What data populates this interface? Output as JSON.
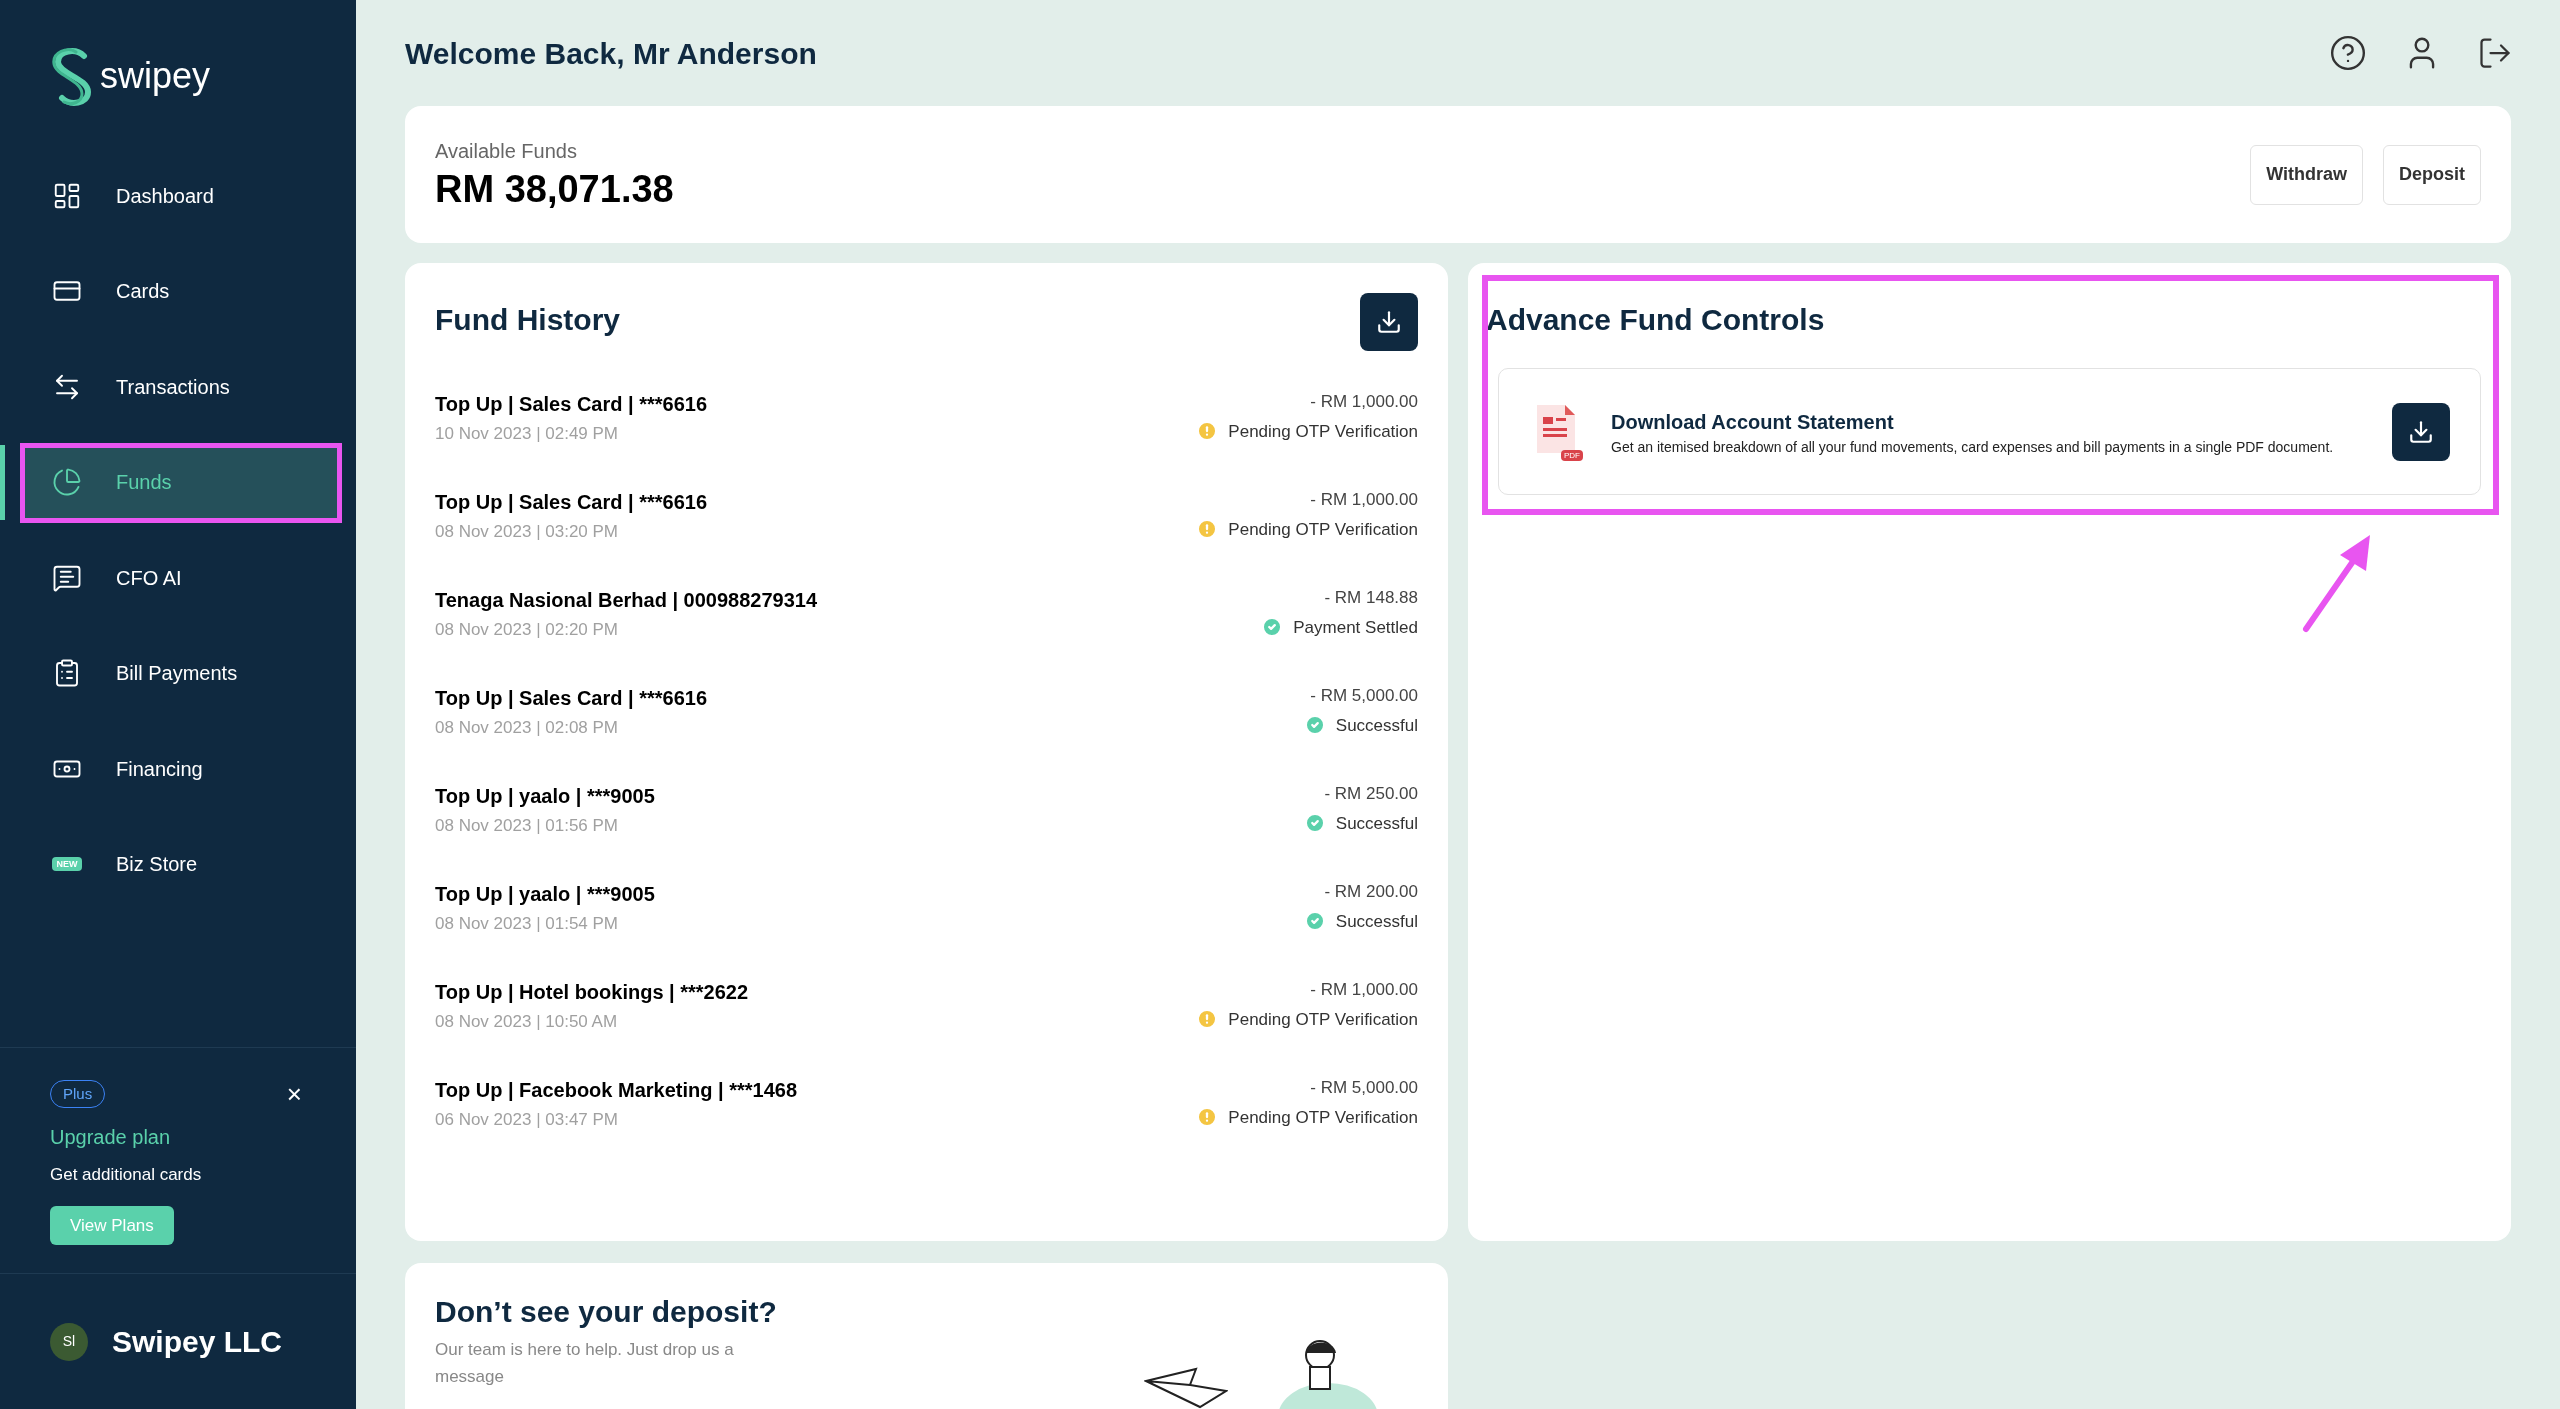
{
  "sidebar": {
    "logo": "swipey",
    "items": [
      {
        "label": "Dashboard",
        "selected": false,
        "annotated": false
      },
      {
        "label": "Cards",
        "selected": false,
        "annotated": false
      },
      {
        "label": "Transactions",
        "selected": false,
        "annotated": false
      },
      {
        "label": "Funds",
        "selected": true,
        "annotated": true
      },
      {
        "label": "CFO AI",
        "selected": false,
        "annotated": false
      },
      {
        "label": "Bill Payments",
        "selected": false,
        "annotated": false
      },
      {
        "label": "Financing",
        "selected": false,
        "annotated": false
      },
      {
        "label": "Biz Store",
        "selected": false,
        "annotated": false,
        "badge": "NEW"
      }
    ],
    "upgrade": {
      "badge": "Plus",
      "close": "×",
      "title": "Upgrade plan",
      "text": "Get additional cards",
      "button": "View Plans"
    },
    "company": {
      "initials": "Sl",
      "name": "Swipey LLC"
    }
  },
  "header": {
    "greeting": "Welcome Back, Mr Anderson"
  },
  "funds": {
    "label": "Available Funds",
    "amount": "RM 38,071.38",
    "buttons": [
      "Withdraw",
      "Deposit"
    ]
  },
  "fund_history": {
    "title": "Fund History",
    "rows": [
      {
        "title": "Top Up | Sales Card | ***6616",
        "date": "10 Nov 2023 | 02:49 PM",
        "amount": "- RM 1,000.00",
        "status": "Pending OTP Verification",
        "kind": "pending"
      },
      {
        "title": "Top Up | Sales Card | ***6616",
        "date": "08 Nov 2023 | 03:20 PM",
        "amount": "- RM 1,000.00",
        "status": "Pending OTP Verification",
        "kind": "pending"
      },
      {
        "title": "Tenaga Nasional Berhad | 000988279314",
        "date": "08 Nov 2023 | 02:20 PM",
        "amount": "- RM 148.88",
        "status": "Payment Settled",
        "kind": "success"
      },
      {
        "title": "Top Up | Sales Card | ***6616",
        "date": "08 Nov 2023 | 02:08 PM",
        "amount": "- RM 5,000.00",
        "status": "Successful",
        "kind": "success"
      },
      {
        "title": "Top Up | yaalo | ***9005",
        "date": "08 Nov 2023 | 01:56 PM",
        "amount": "- RM 250.00",
        "status": "Successful",
        "kind": "success"
      },
      {
        "title": "Top Up | yaalo | ***9005",
        "date": "08 Nov 2023 | 01:54 PM",
        "amount": "- RM 200.00",
        "status": "Successful",
        "kind": "success"
      },
      {
        "title": "Top Up | Hotel bookings | ***2622",
        "date": "08 Nov 2023 | 10:50 AM",
        "amount": "- RM 1,000.00",
        "status": "Pending OTP Verification",
        "kind": "pending"
      },
      {
        "title": "Top Up | Facebook Marketing | ***1468",
        "date": "06 Nov 2023 | 03:47 PM",
        "amount": "- RM 5,000.00",
        "status": "Pending OTP Verification",
        "kind": "pending"
      }
    ]
  },
  "advance": {
    "title": "Advance Fund Controls",
    "annotated": true,
    "statement": {
      "title": "Download Account Statement",
      "text": "Get an itemised breakdown of all your fund movements, card expenses and bill payments in a single PDF document.",
      "file_badge": "PDF"
    }
  },
  "deposit_help": {
    "title": "Don’t see your deposit?",
    "text": "Our team is here to help. Just drop us a message"
  }
}
